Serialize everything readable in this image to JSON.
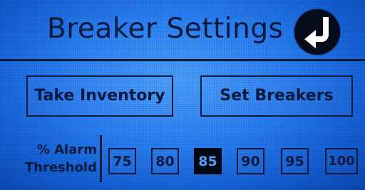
{
  "header": {
    "title": "Breaker Settings"
  },
  "actions": {
    "take_inventory_label": "Take Inventory",
    "set_breakers_label": "Set Breakers"
  },
  "alarm_threshold": {
    "label_line_1": "% Alarm",
    "label_line_2": "Threshold",
    "options": [
      "75",
      "80",
      "85",
      "90",
      "95",
      "100"
    ],
    "selected": "85"
  },
  "icons": {
    "back": "return-arrow-icon"
  },
  "colors": {
    "screen_blue": "#2a7ff4",
    "text_dark": "#061a3f",
    "selected_background": "#030914"
  }
}
